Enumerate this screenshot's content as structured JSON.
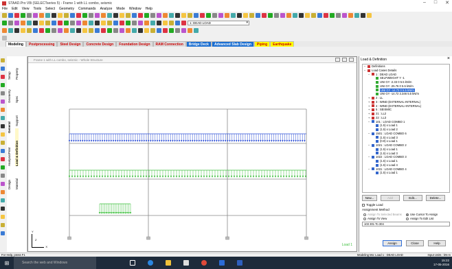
{
  "app": {
    "title": "STAAD.Pro V8i (SELECTseries 5) - Frame 1 with LL combo, seismic",
    "menus": [
      "File",
      "Edit",
      "View",
      "Tools",
      "Select",
      "Geometry",
      "Commands",
      "Analyze",
      "Mode",
      "Window",
      "Help"
    ],
    "load_dropdown": "1: DEAD LOAD"
  },
  "tabs": [
    {
      "label": "Modeling",
      "style": "active"
    },
    {
      "label": "Postprocessing",
      "style": ""
    },
    {
      "label": "Steel Design",
      "style": ""
    },
    {
      "label": "Concrete Design",
      "style": ""
    },
    {
      "label": "Foundation Design",
      "style": ""
    },
    {
      "label": "RAM Connection",
      "style": ""
    },
    {
      "label": "Bridge Deck",
      "style": "blue"
    },
    {
      "label": "Advanced Slab Design",
      "style": "blue"
    },
    {
      "label": "Piping",
      "style": "hl"
    },
    {
      "label": "Earthquake",
      "style": "hl"
    }
  ],
  "page_control": [
    "Setup",
    "Geometry",
    "General",
    "Analysis/Print",
    "Design"
  ],
  "sub_tabs": [
    "Property",
    "Spec",
    "Support",
    "Load & Definition",
    "Material"
  ],
  "view": {
    "title": "Frame 1 with LL combo, seismic - Whole Structure",
    "load_label": "Load 1",
    "axis_y": "Y",
    "axis_x": "X",
    "axis_z": "Z"
  },
  "panel": {
    "title": "Load & Definition",
    "tree": [
      {
        "indent": 0,
        "icon": "minus",
        "label": "Definitions",
        "color": "#c33"
      },
      {
        "indent": 0,
        "icon": "minus",
        "label": "Load Cases Details",
        "color": "#c33"
      },
      {
        "indent": 1,
        "icon": "minus",
        "label": "1 : DEAD LOAD",
        "color": "#c33"
      },
      {
        "indent": 2,
        "icon": "leaf",
        "label": "SELFWEIGHT Y -1",
        "color": "#3a3"
      },
      {
        "indent": 2,
        "icon": "leaf",
        "label": "UNI GY -2.33 0 5.5 kN/m",
        "color": "#3a3"
      },
      {
        "indent": 2,
        "icon": "leaf",
        "label": "UNI GY -25.76 0 5.5 kN/m",
        "color": "#3a3"
      },
      {
        "indent": 2,
        "icon": "leaf",
        "label": "UNI GY -14.72 0 5.5 kN/m",
        "color": "#3a3",
        "selected": true
      },
      {
        "indent": 2,
        "icon": "leaf",
        "label": "UNI GY -14.72 3.346 5.5 kN/m",
        "color": "#3a3"
      },
      {
        "indent": 1,
        "icon": "plus",
        "label": "2 : LL",
        "color": "#c33"
      },
      {
        "indent": 1,
        "icon": "plus",
        "label": "3 : WIND (EXTERNAL-INTERNAL)",
        "color": "#c33"
      },
      {
        "indent": 1,
        "icon": "plus",
        "label": "4 : WIND (EXTERNAL+INTERNAL)",
        "color": "#c33"
      },
      {
        "indent": 1,
        "icon": "plus",
        "label": "5 : SEISMIC",
        "color": "#c33"
      },
      {
        "indent": 1,
        "icon": "plus",
        "label": "21 : LL2",
        "color": "#c33"
      },
      {
        "indent": 1,
        "icon": "plus",
        "label": "22 : LL3",
        "color": "#c33"
      },
      {
        "indent": 1,
        "icon": "minus",
        "label": "101 : LOAD COMBO 1",
        "color": "#36c"
      },
      {
        "indent": 2,
        "icon": "leaf",
        "label": "(1.5) x Load 1",
        "color": "#36c"
      },
      {
        "indent": 2,
        "icon": "leaf",
        "label": "(1.5) x Load 2",
        "color": "#36c"
      },
      {
        "indent": 1,
        "icon": "minus",
        "label": "1501 : LOAD COMBO 6",
        "color": "#36c"
      },
      {
        "indent": 2,
        "icon": "leaf",
        "label": "(1.5) x Load 3",
        "color": "#36c"
      },
      {
        "indent": 2,
        "icon": "leaf",
        "label": "(0.9) x Load 1",
        "color": "#36c"
      },
      {
        "indent": 1,
        "icon": "minus",
        "label": "1021 : LOAD COMBO 2",
        "color": "#36c"
      },
      {
        "indent": 2,
        "icon": "leaf",
        "label": "(1.5) x Load 1",
        "color": "#36c"
      },
      {
        "indent": 2,
        "icon": "leaf",
        "label": "(1.5) x Load 3",
        "color": "#36c"
      },
      {
        "indent": 1,
        "icon": "minus",
        "label": "1022 : LOAD COMBO 3",
        "color": "#36c"
      },
      {
        "indent": 2,
        "icon": "leaf",
        "label": "(1.5) x Load 1",
        "color": "#36c"
      },
      {
        "indent": 2,
        "icon": "leaf",
        "label": "(1.5) x Load 4",
        "color": "#36c"
      },
      {
        "indent": 1,
        "icon": "minus",
        "label": "1031 : LOAD COMBO 4",
        "color": "#36c"
      },
      {
        "indent": 2,
        "icon": "leaf",
        "label": "(1.5) x Load 1",
        "color": "#36c"
      }
    ],
    "buttons": {
      "new": "New...",
      "add": "Add",
      "edit": "Edit...",
      "delete": "Delete..."
    },
    "toggle_load": "Toggle Load",
    "assignment_method": "Assignment Method",
    "assign_selected": "Assign To Selected Beams",
    "use_cursor": "Use Cursor To Assign",
    "assign_view": "Assign To View",
    "assign_edit": "Assign To Edit List",
    "edit_list": "103 301 To 304",
    "assign_btn": "Assign",
    "close_btn": "Close",
    "help_btn": "Help"
  },
  "status": {
    "left": "For Help, press F1",
    "mid": "Modeling Mo: Load 1 : DEAD LOAD",
    "right": "Input Units : kN-m"
  },
  "taskbar": {
    "search": "Search the web and Windows",
    "time": "15:22",
    "date": "17-05-2016"
  },
  "colors": {
    "load_blue": "#2c4fd6",
    "load_green": "#3cbf3c",
    "frame": "#888888"
  }
}
